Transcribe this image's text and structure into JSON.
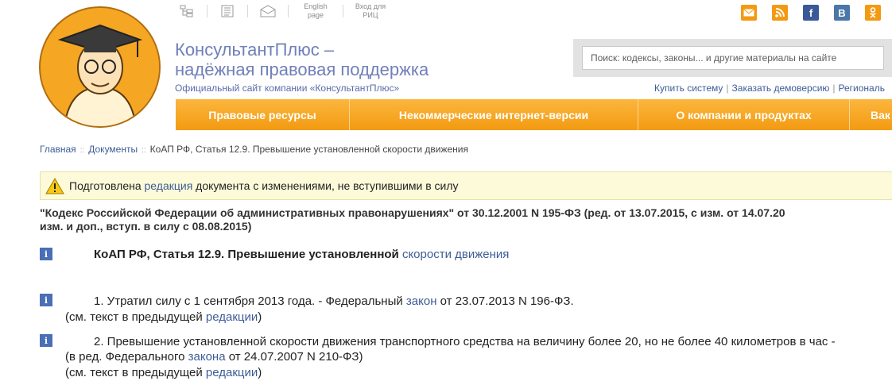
{
  "top_links": {
    "english": "English page",
    "enter": "Вход для РИЦ"
  },
  "brand": {
    "line1": "КонсультантПлюс –",
    "line2": "надёжная правовая поддержка",
    "subtitle": "Официальный сайт компании «КонсультантПлюс»"
  },
  "search": {
    "placeholder": "Поиск: кодексы, законы... и другие материалы на сайте"
  },
  "header_links": [
    "Купить систему",
    "Заказать демоверсию",
    "Региональ"
  ],
  "nav": [
    "Правовые ресурсы",
    "Некоммерческие интернет-версии",
    "О компании и продуктах",
    "Вак"
  ],
  "breadcrumb": {
    "home": "Главная",
    "docs": "Документы",
    "current": "КоАП РФ, Статья 12.9. Превышение установленной скорости движения"
  },
  "notice": {
    "before": "Подготовлена ",
    "link": "редакция",
    "after": " документа с изменениями, не вступившими в силу"
  },
  "doc_title": {
    "line1": "\"Кодекс Российской Федерации об административных правонарушениях\" от 30.12.2001 N 195-ФЗ (ред. от 13.07.2015, с изм. от 14.07.20",
    "line2": "изм. и доп., вступ. в силу с 08.08.2015)"
  },
  "article": {
    "text": "КоАП РФ, Статья 12.9. Превышение установленной ",
    "link": "скорости движения"
  },
  "p1": {
    "text": "1. Утратил силу с 1 сентября 2013 года. - Федеральный ",
    "link": "закон",
    "after": " от 23.07.2013 N 196-ФЗ.",
    "note_before": "(см. текст в предыдущей ",
    "note_link": "редакции",
    "note_after": ")"
  },
  "p2": {
    "line1": "2. Превышение установленной скорости движения транспортного средства на величину более 20, но не более 40 километров в час -",
    "line2_before": "(в ред. Федерального ",
    "line2_link": "закона",
    "line2_after": " от 24.07.2007 N 210-ФЗ)",
    "note_before": "(см. текст в предыдущей ",
    "note_link": "редакции",
    "note_after": ")"
  },
  "icons": [
    "sitemap-icon",
    "newspaper-icon",
    "mail-icon",
    "email-icon",
    "rss-icon",
    "facebook-icon",
    "vkontakte-icon",
    "odnoklassniki-icon",
    "warning-icon",
    "info-icon"
  ],
  "colors": {
    "nav": "#f7a623",
    "brand": "#7080b8",
    "link": "#3d5c96",
    "notice_bg": "#fcfad9"
  }
}
